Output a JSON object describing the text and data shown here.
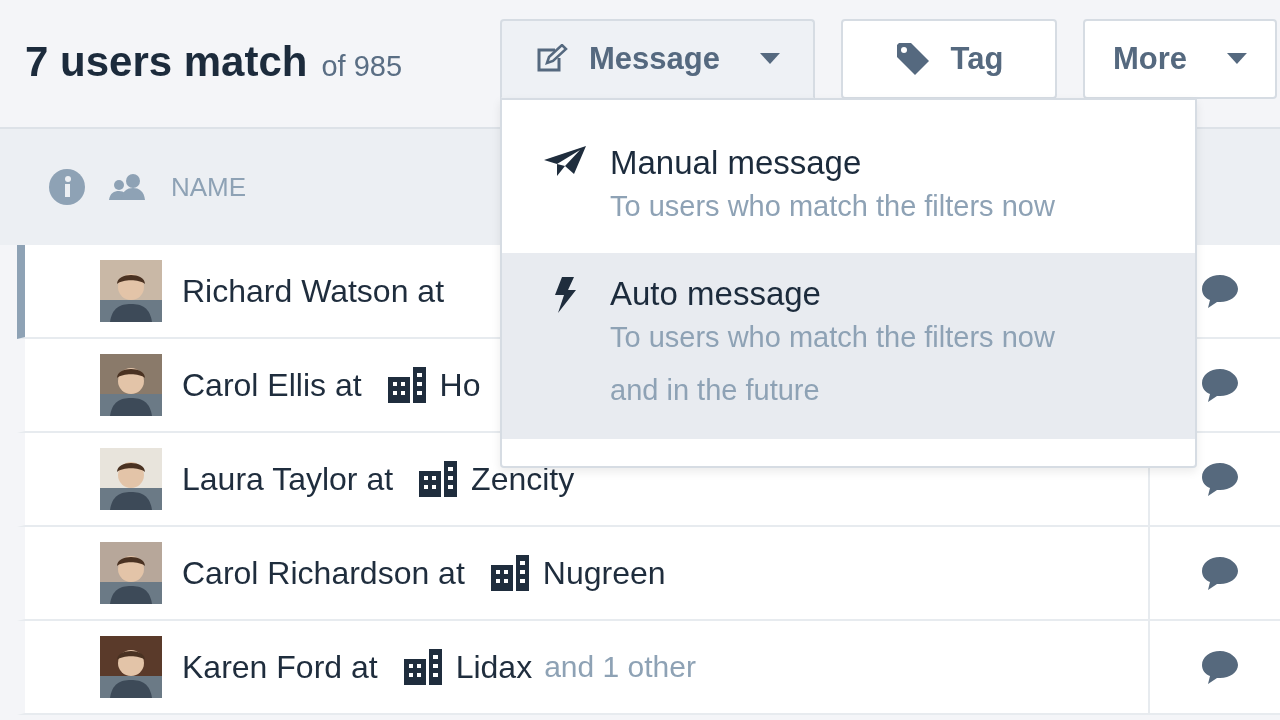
{
  "header": {
    "title": "7 users match",
    "total": "of 985"
  },
  "buttons": [
    {
      "kind": "message",
      "label": "Message",
      "open": true
    },
    {
      "kind": "tag",
      "label": "Tag",
      "open": false
    },
    {
      "kind": "more",
      "label": "More",
      "open": false
    }
  ],
  "menu": {
    "items": [
      {
        "kind": "manual",
        "title": "Manual message",
        "subtitle": "To users who match the filters now",
        "selected": false
      },
      {
        "kind": "auto",
        "title": "Auto message",
        "subtitle": "To users who match the filters now and in the future",
        "selected": true
      }
    ]
  },
  "table": {
    "column": "NAME",
    "rows": [
      {
        "name": "Richard Watson at",
        "selected": true
      },
      {
        "name": "Carol Ellis at",
        "company": "Ho",
        "selected": false
      },
      {
        "name": "Laura Taylor at",
        "company": "Zencity",
        "selected": false
      },
      {
        "name": "Carol Richardson at",
        "company": "Nugreen",
        "selected": false
      },
      {
        "name": "Karen Ford at",
        "company": "Lidax",
        "extra": "and 1 other",
        "selected": false
      }
    ]
  }
}
